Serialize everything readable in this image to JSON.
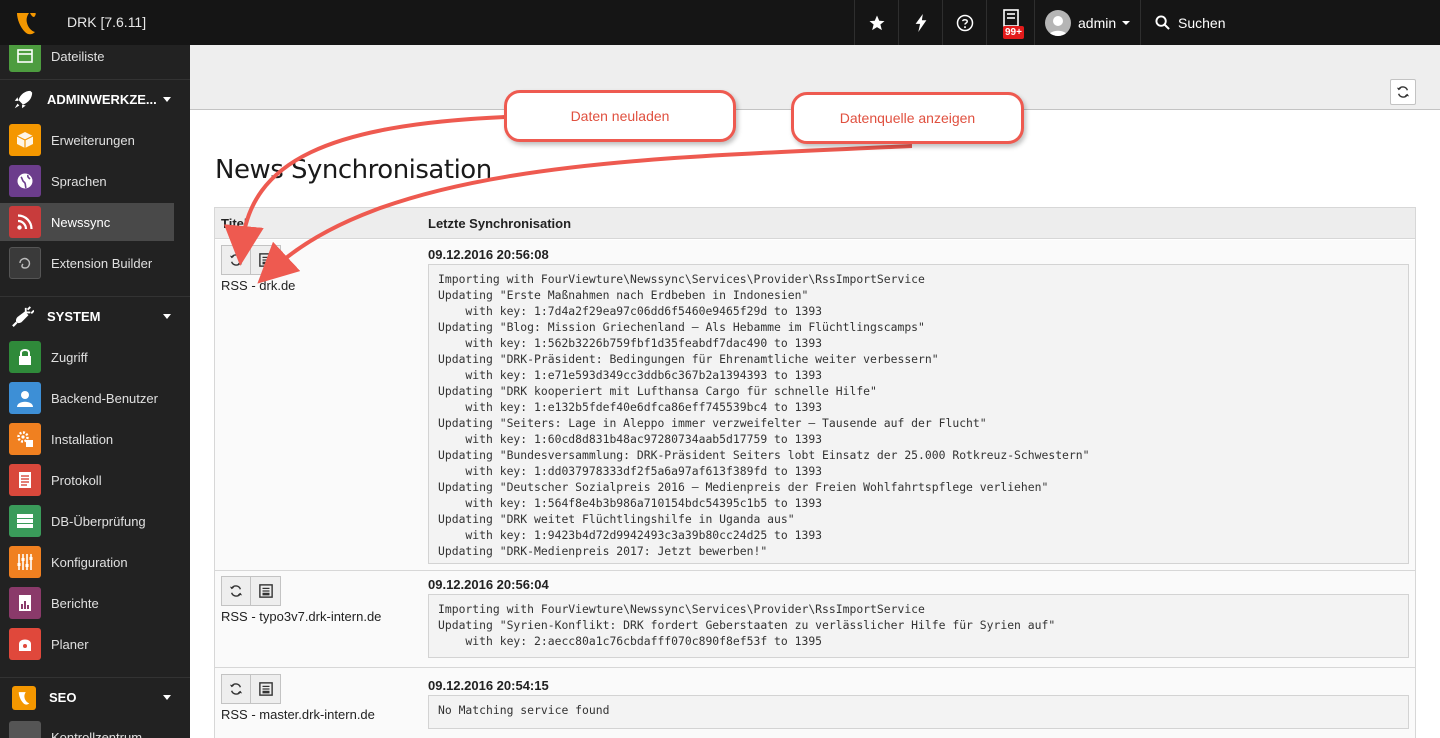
{
  "app": {
    "site_name": "DRK [7.6.11]"
  },
  "topbar": {
    "badge": "99+",
    "user_name": "admin",
    "search_label": "Suchen"
  },
  "sidebar": {
    "items": [
      {
        "label": "Dateiliste",
        "color": "#4d9c3f"
      },
      {
        "label": "Erweiterungen",
        "color": "#f49700"
      },
      {
        "label": "Sprachen",
        "color": "#6c3d8c"
      },
      {
        "label": "Newssync",
        "color": "#c83c3c"
      },
      {
        "label": "Extension Builder",
        "color": "#3a3a3a"
      },
      {
        "label": "Zugriff",
        "color": "#2f8a3a"
      },
      {
        "label": "Backend-Benutzer",
        "color": "#3d8fd6"
      },
      {
        "label": "Installation",
        "color": "#f08020"
      },
      {
        "label": "Protokoll",
        "color": "#d9483b"
      },
      {
        "label": "DB-Überprüfung",
        "color": "#3a9b5a"
      },
      {
        "label": "Konfiguration",
        "color": "#f08020"
      },
      {
        "label": "Berichte",
        "color": "#8a3a6a"
      },
      {
        "label": "Planer",
        "color": "#e0483b"
      },
      {
        "label": "Kontrollzentrum",
        "color": "#555555"
      }
    ],
    "groups": [
      {
        "label": "ADMINWERKZE..."
      },
      {
        "label": "SYSTEM"
      },
      {
        "label": "SEO"
      }
    ]
  },
  "main": {
    "title": "News Synchronisation",
    "col_title": "Titel",
    "col_last_sync": "Letzte Synchronisation",
    "rows": [
      {
        "title": "RSS - drk.de",
        "date": "09.12.2016 20:56:08",
        "log": "Importing with FourViewture\\Newssync\\Services\\Provider\\RssImportService\nUpdating \"Erste Maßnahmen nach Erdbeben in Indonesien\"\n    with key: 1:7d4a2f29ea97c06dd6f5460e9465f29d to 1393\nUpdating \"Blog: Mission Griechenland – Als Hebamme im Flüchtlingscamps\"\n    with key: 1:562b3226b759fbf1d35feabdf7dac490 to 1393\nUpdating \"DRK-Präsident: Bedingungen für Ehrenamtliche weiter verbessern\"\n    with key: 1:e71e593d349cc3ddb6c367b2a1394393 to 1393\nUpdating \"DRK kooperiert mit Lufthansa Cargo für schnelle Hilfe\"\n    with key: 1:e132b5fdef40e6dfca86eff745539bc4 to 1393\nUpdating \"Seiters: Lage in Aleppo immer verzweifelter – Tausende auf der Flucht\"\n    with key: 1:60cd8d831b48ac97280734aab5d17759 to 1393\nUpdating \"Bundesversammlung: DRK-Präsident Seiters lobt Einsatz der 25.000 Rotkreuz-Schwestern\"\n    with key: 1:dd037978333df2f5a6a97af613f389fd to 1393\nUpdating \"Deutscher Sozialpreis 2016 – Medienpreis der Freien Wohlfahrtspflege verliehen\"\n    with key: 1:564f8e4b3b986a710154bdc54395c1b5 to 1393\nUpdating \"DRK weitet Flüchtlingshilfe in Uganda aus\"\n    with key: 1:9423b4d72d9942493c3a39b80cc24d25 to 1393\nUpdating \"DRK-Medienpreis 2017: Jetzt bewerben!\""
      },
      {
        "title": "RSS - typo3v7.drk-intern.de",
        "date": "09.12.2016 20:56:04",
        "log": "Importing with FourViewture\\Newssync\\Services\\Provider\\RssImportService\nUpdating \"Syrien-Konflikt: DRK fordert Geberstaaten zu verlässlicher Hilfe für Syrien auf\"\n    with key: 2:aecc80a1c76cbdafff070c890f8ef53f to 1395"
      },
      {
        "title": "RSS - master.drk-intern.de",
        "date": "09.12.2016 20:54:15",
        "log": "No Matching service found"
      }
    ]
  },
  "callouts": {
    "reload": "Daten neuladen",
    "show_source": "Datenquelle anzeigen",
    "color": "#ee5a50"
  }
}
